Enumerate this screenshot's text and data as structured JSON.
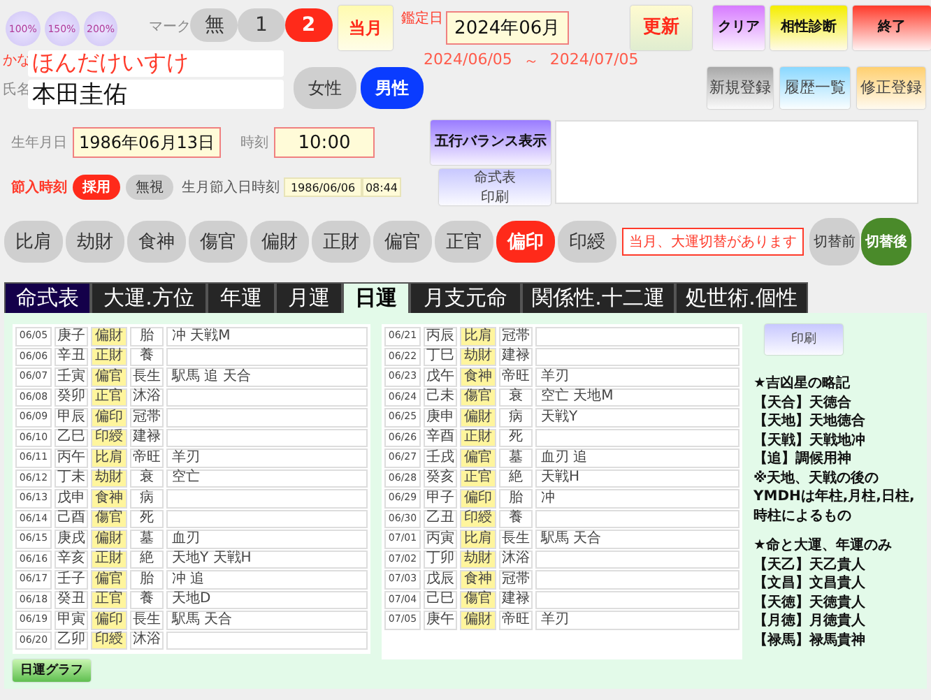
{
  "zoom_buttons": [
    "100%",
    "150%",
    "200%"
  ],
  "mark": {
    "label": "マーク",
    "options": [
      {
        "label": "無",
        "selected": false
      },
      {
        "label": "1",
        "selected": false
      },
      {
        "label": "2",
        "selected": true
      }
    ]
  },
  "current_month_button": "当月",
  "appraisal_date": {
    "label": "鑑定日",
    "value": "2024年06月",
    "range_start": "2024/06/05",
    "range_sep": "～",
    "range_end": "2024/07/05"
  },
  "top_buttons": [
    {
      "label": "更新",
      "kind": "update"
    },
    {
      "label": "クリア",
      "kind": "clear"
    },
    {
      "label": "相性診断",
      "kind": "compat"
    },
    {
      "label": "終了",
      "kind": "exit"
    }
  ],
  "kana": {
    "label": "かな",
    "value": "ほんだけいすけ"
  },
  "name": {
    "label": "氏名",
    "value": "本田圭佑"
  },
  "gender": [
    {
      "label": "女性",
      "selected": false
    },
    {
      "label": "男性",
      "selected": true
    }
  ],
  "register_buttons": [
    {
      "label": "新規登録",
      "kind": "new"
    },
    {
      "label": "履歴一覧",
      "kind": "history"
    },
    {
      "label": "修正登録",
      "kind": "edit"
    }
  ],
  "birth_date": {
    "label": "生年月日",
    "value": "1986年06月13日"
  },
  "birth_time": {
    "label": "時刻",
    "value": "10:00"
  },
  "balance_button": "五行バランス表示",
  "setsuiri": {
    "label": "節入時刻",
    "options": [
      {
        "label": "採用",
        "selected": true
      },
      {
        "label": "無視",
        "selected": false
      }
    ]
  },
  "birth_month_setsuiri": {
    "label": "生月節入日時刻",
    "date": "1986/06/06",
    "time": "08:44"
  },
  "chart_print_button": [
    "命式表",
    "印刷"
  ],
  "stars": [
    {
      "label": "比肩",
      "selected": false
    },
    {
      "label": "劫財",
      "selected": false
    },
    {
      "label": "食神",
      "selected": false
    },
    {
      "label": "傷官",
      "selected": false
    },
    {
      "label": "偏財",
      "selected": false
    },
    {
      "label": "正財",
      "selected": false
    },
    {
      "label": "偏官",
      "selected": false
    },
    {
      "label": "正官",
      "selected": false
    },
    {
      "label": "偏印",
      "selected": true
    },
    {
      "label": "印綬",
      "selected": false
    }
  ],
  "notice": "当月、大運切替があります",
  "switch": [
    {
      "label": "切替前",
      "selected": false
    },
    {
      "label": "切替後",
      "selected": true
    }
  ],
  "tabs": [
    {
      "label": "命式表",
      "kind": "main",
      "selected": false
    },
    {
      "label": "大運.方位",
      "kind": "sub",
      "selected": false
    },
    {
      "label": "年運",
      "kind": "sub",
      "selected": false
    },
    {
      "label": "月運",
      "kind": "sub",
      "selected": false
    },
    {
      "label": "日運",
      "kind": "sub",
      "selected": true
    },
    {
      "label": "月支元命",
      "kind": "sub",
      "selected": false
    },
    {
      "label": "関係性.十二運",
      "kind": "sub",
      "selected": false
    },
    {
      "label": "処世術.個性",
      "kind": "sub",
      "selected": false
    }
  ],
  "daily_tables": [
    [
      {
        "date": "06/05",
        "stem_branch": "庚子",
        "star": "偏財",
        "fortune": "胎",
        "notes": "冲 天戦M"
      },
      {
        "date": "06/06",
        "stem_branch": "辛丑",
        "star": "正財",
        "fortune": "養"
      },
      {
        "date": "06/07",
        "stem_branch": "壬寅",
        "star": "偏官",
        "fortune": "長生",
        "notes": "駅馬 追 天合"
      },
      {
        "date": "06/08",
        "stem_branch": "癸卯",
        "star": "正官",
        "fortune": "沐浴"
      },
      {
        "date": "06/09",
        "stem_branch": "甲辰",
        "star": "偏印",
        "fortune": "冠帯"
      },
      {
        "date": "06/10",
        "stem_branch": "乙巳",
        "star": "印綬",
        "fortune": "建禄"
      },
      {
        "date": "06/11",
        "stem_branch": "丙午",
        "star": "比肩",
        "fortune": "帝旺",
        "notes": "羊刃"
      },
      {
        "date": "06/12",
        "stem_branch": "丁未",
        "star": "劫財",
        "fortune": "衰",
        "notes": "空亡"
      },
      {
        "date": "06/13",
        "stem_branch": "戊申",
        "star": "食神",
        "fortune": "病"
      },
      {
        "date": "06/14",
        "stem_branch": "己酉",
        "star": "傷官",
        "fortune": "死"
      },
      {
        "date": "06/15",
        "stem_branch": "庚戌",
        "star": "偏財",
        "fortune": "墓",
        "notes": "血刃"
      },
      {
        "date": "06/16",
        "stem_branch": "辛亥",
        "star": "正財",
        "fortune": "絶",
        "notes": "天地Y 天戦H"
      },
      {
        "date": "06/17",
        "stem_branch": "壬子",
        "star": "偏官",
        "fortune": "胎",
        "notes": "冲 追"
      },
      {
        "date": "06/18",
        "stem_branch": "癸丑",
        "star": "正官",
        "fortune": "養",
        "notes": "天地D"
      },
      {
        "date": "06/19",
        "stem_branch": "甲寅",
        "star": "偏印",
        "fortune": "長生",
        "notes": "駅馬 天合"
      },
      {
        "date": "06/20",
        "stem_branch": "乙卯",
        "star": "印綬",
        "fortune": "沐浴"
      }
    ],
    [
      {
        "date": "06/21",
        "stem_branch": "丙辰",
        "star": "比肩",
        "fortune": "冠帯"
      },
      {
        "date": "06/22",
        "stem_branch": "丁巳",
        "star": "劫財",
        "fortune": "建禄"
      },
      {
        "date": "06/23",
        "stem_branch": "戊午",
        "star": "食神",
        "fortune": "帝旺",
        "notes": "羊刃"
      },
      {
        "date": "06/24",
        "stem_branch": "己未",
        "star": "傷官",
        "fortune": "衰",
        "notes": "空亡 天地M"
      },
      {
        "date": "06/25",
        "stem_branch": "庚申",
        "star": "偏財",
        "fortune": "病",
        "notes": "天戦Y"
      },
      {
        "date": "06/26",
        "stem_branch": "辛酉",
        "star": "正財",
        "fortune": "死"
      },
      {
        "date": "06/27",
        "stem_branch": "壬戌",
        "star": "偏官",
        "fortune": "墓",
        "notes": "血刃 追"
      },
      {
        "date": "06/28",
        "stem_branch": "癸亥",
        "star": "正官",
        "fortune": "絶",
        "notes": "天戦H"
      },
      {
        "date": "06/29",
        "stem_branch": "甲子",
        "star": "偏印",
        "fortune": "胎",
        "notes": "冲"
      },
      {
        "date": "06/30",
        "stem_branch": "乙丑",
        "star": "印綬",
        "fortune": "養"
      },
      {
        "date": "07/01",
        "stem_branch": "丙寅",
        "star": "比肩",
        "fortune": "長生",
        "notes": "駅馬 天合"
      },
      {
        "date": "07/02",
        "stem_branch": "丁卯",
        "star": "劫財",
        "fortune": "沐浴"
      },
      {
        "date": "07/03",
        "stem_branch": "戊辰",
        "star": "食神",
        "fortune": "冠帯"
      },
      {
        "date": "07/04",
        "stem_branch": "己巳",
        "star": "傷官",
        "fortune": "建禄"
      },
      {
        "date": "07/05",
        "stem_branch": "庚午",
        "star": "偏財",
        "fortune": "帝旺",
        "notes": "羊刃"
      }
    ]
  ],
  "graph_button": "日運グラフ",
  "print_button": "印刷",
  "legend": [
    {
      "kind": "heading",
      "text": "★吉凶星の略記"
    },
    {
      "kind": "item",
      "text": "【天合】天徳合"
    },
    {
      "kind": "item",
      "text": "【天地】天地徳合"
    },
    {
      "kind": "item",
      "text": "【天戦】天戦地冲"
    },
    {
      "kind": "item",
      "text": "【追】調候用神"
    },
    {
      "kind": "note",
      "text": "※天地、天戦の後のYMDHは年柱,月柱,日柱,時柱によるもの"
    },
    {
      "kind": "heading",
      "text": "★命と大運、年運のみ"
    },
    {
      "kind": "item",
      "text": "【天乙】天乙貴人"
    },
    {
      "kind": "item",
      "text": "【文昌】文昌貴人"
    },
    {
      "kind": "item",
      "text": "【天徳】天徳貴人"
    },
    {
      "kind": "item",
      "text": "【月徳】月徳貴人"
    },
    {
      "kind": "item",
      "text": "【禄馬】禄馬貴神"
    }
  ]
}
